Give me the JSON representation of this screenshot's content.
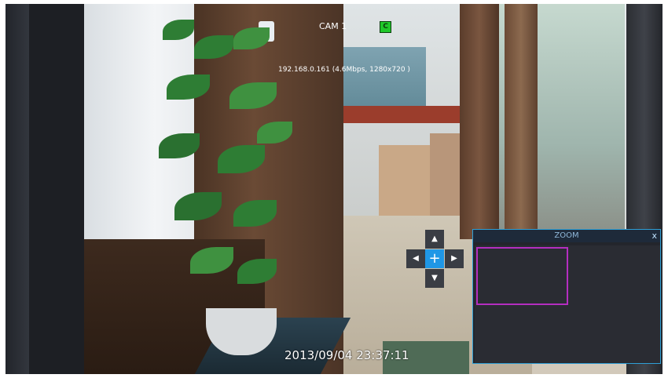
{
  "osd": {
    "camera_label": "CAM 1",
    "camera_badge": "C",
    "stream_info": "192.168.0.161 (4.6Mbps, 1280x720 )",
    "timestamp": "2013/09/04 23:37:11"
  },
  "ptz": {
    "up_icon": "▲",
    "down_icon": "▼",
    "left_icon": "◀",
    "right_icon": "▶",
    "center_icon": "+"
  },
  "zoom_panel": {
    "title": "ZOOM",
    "close_label": "x",
    "selection_color": "#b42ec0",
    "border_color": "#2f9fd6"
  },
  "colors": {
    "badge_green": "#20c82a",
    "ptz_center_blue": "#1f97e6"
  }
}
